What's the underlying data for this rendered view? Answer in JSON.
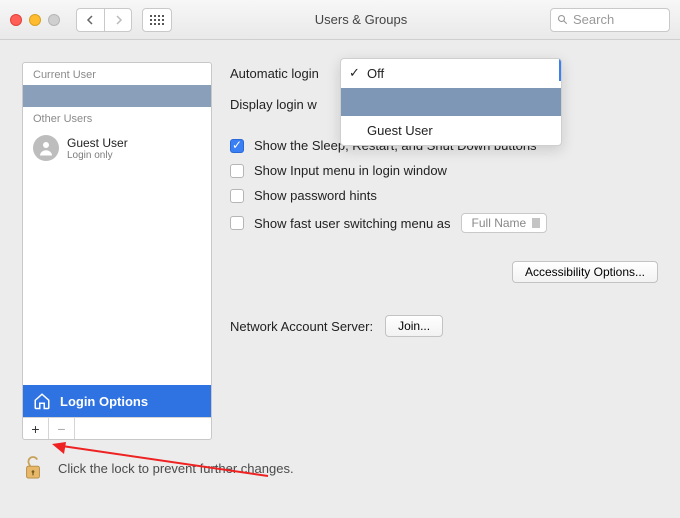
{
  "titlebar": {
    "title": "Users & Groups",
    "search_placeholder": "Search"
  },
  "sidebar": {
    "current_label": "Current User",
    "other_label": "Other Users",
    "guest": {
      "name": "Guest User",
      "sub": "Login only"
    },
    "login_options": "Login Options"
  },
  "dropdown": {
    "off": "Off",
    "guest": "Guest User"
  },
  "main": {
    "automatic_login_label": "Automatic login",
    "display_login_label": "Display login w",
    "cb_sleep": "Show the Sleep, Restart, and Shut Down buttons",
    "cb_input": "Show Input menu in login window",
    "cb_hints": "Show password hints",
    "cb_fast": "Show fast user switching menu as",
    "fast_value": "Full Name",
    "accessibility": "Accessibility Options...",
    "network_label": "Network Account Server:",
    "join": "Join..."
  },
  "lock": {
    "text": "Click the lock to prevent further changes."
  }
}
